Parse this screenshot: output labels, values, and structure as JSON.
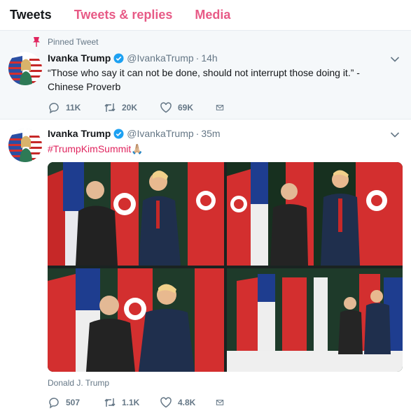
{
  "tabs": [
    "Tweets",
    "Tweets & replies",
    "Media"
  ],
  "tweets": [
    {
      "pinned_label": "Pinned Tweet",
      "name": "Ivanka Trump",
      "handle": "@IvankaTrump",
      "time": "14h",
      "text": "“Those who say it can not be done, should not interrupt those doing it.”  - Chinese Proverb",
      "replies": "11K",
      "retweets": "20K",
      "likes": "69K"
    },
    {
      "name": "Ivanka Trump",
      "handle": "@IvankaTrump",
      "time": "35m",
      "hashtag": "#TrumpKimSummit",
      "emoji": "🙏🏼",
      "photo_credit": "Donald J. Trump",
      "replies": "507",
      "retweets": "1.1K",
      "likes": "4.8K"
    }
  ],
  "colors": {
    "accent": "#e0245e",
    "verified": "#1da1f2",
    "muted": "#657786",
    "pinned_bg": "#f5f8fa",
    "divider": "#e6ecf0"
  },
  "icons": [
    "pin-icon",
    "verified-icon",
    "chevron-down-icon",
    "reply-icon",
    "retweet-icon",
    "like-icon",
    "message-icon"
  ]
}
